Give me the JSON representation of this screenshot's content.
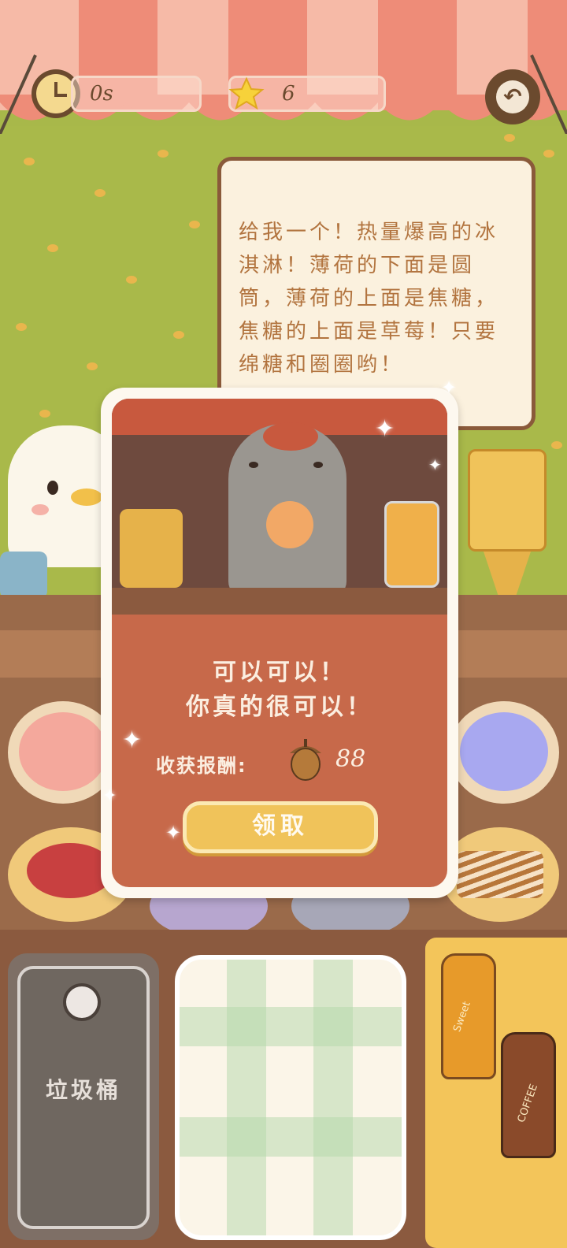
{
  "hud": {
    "timer_value": "0s",
    "star_count": "6"
  },
  "customer_order": {
    "text": "给我一个！热量爆高的冰淇淋！薄荷的下面是圆筒，薄荷的上面是焦糖，焦糖的上面是草莓！只要绵糖和圈圈哟！"
  },
  "result_dialog": {
    "title_line1": "可以可以！",
    "title_line2": "你真的很可以！",
    "reward_label": "收获报酬:",
    "reward_amount": "88",
    "claim_label": "领取"
  },
  "trash": {
    "label": "垃圾桶"
  },
  "bottles": {
    "sweet_label": "Sweet",
    "coffee_label": "COFFEE"
  },
  "colors": {
    "awning_red": "#ee8c78",
    "awning_light": "#fbd9c6",
    "wall_green": "#a9b94a",
    "dialog_orange": "#c7694a",
    "button_yellow": "#f0c35a",
    "text_brown": "#b2743f"
  }
}
